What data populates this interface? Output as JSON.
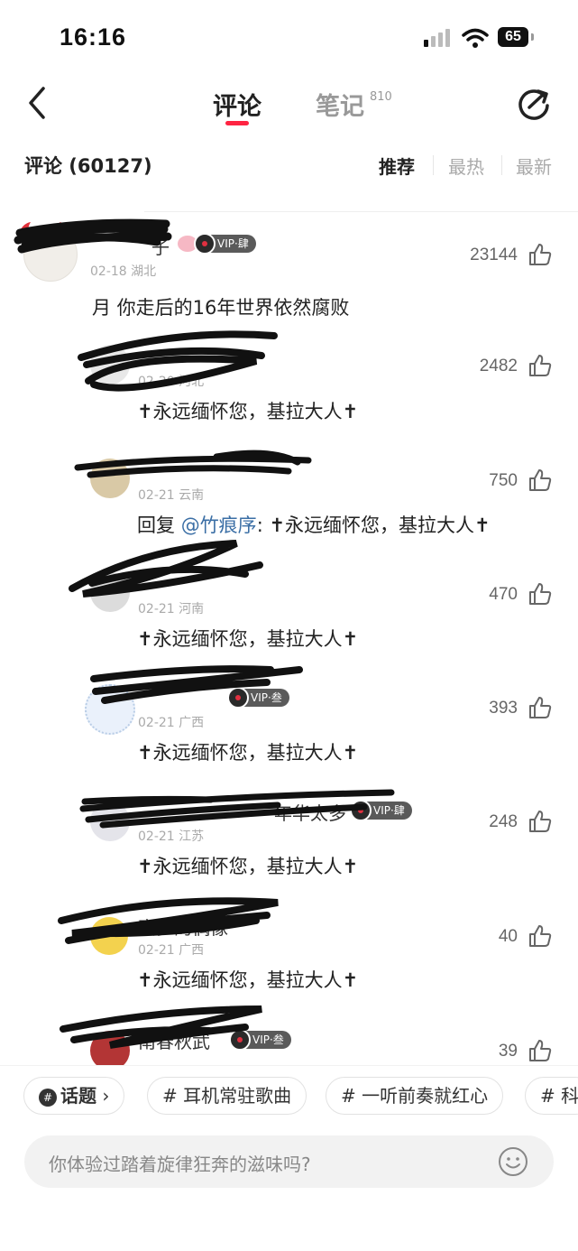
{
  "status_bar": {
    "time": "16:16",
    "battery": "65"
  },
  "nav": {
    "tab_comments": "评论",
    "tab_notes": "笔记",
    "notes_count": "810"
  },
  "header": {
    "comment_title": "评论 (60127)",
    "sort_options": [
      "推荐",
      "最热",
      "最新"
    ]
  },
  "comments": [
    {
      "username": "子",
      "vip": "VIP·肆",
      "meta": "02-18 湖北",
      "likes": "23144",
      "text": "月 你走后的16年世界依然腐败"
    },
    {
      "username": "",
      "meta": "02-20 河北",
      "likes": "2482",
      "text": "✝永远缅怀您，基拉大人✝"
    },
    {
      "username": "",
      "meta": "02-21 云南",
      "likes": "750",
      "text_prefix": "回复 ",
      "mention": "@竹痕序",
      "text": ": ✝永远缅怀您，基拉大人✝"
    },
    {
      "username": "",
      "meta": "02-21 河南",
      "likes": "470",
      "text": "✝永远缅怀您，基拉大人✝"
    },
    {
      "username": "",
      "vip": "VIP·叁",
      "meta": "02-21 广西",
      "likes": "393",
      "text": "✝永远缅怀您，基拉大人✝"
    },
    {
      "username": "年华太多",
      "vip": "VIP·肆",
      "meta": "02-21 江苏",
      "likes": "248",
      "text": "✝永远缅怀您，基拉大人✝"
    },
    {
      "username": "赛罗的偶像",
      "meta": "02-21 广西",
      "likes": "40",
      "text": "✝永远缅怀您，基拉大人✝"
    },
    {
      "username": "南春秋武",
      "vip": "VIP·叁",
      "meta": "",
      "likes": "39",
      "text": ""
    }
  ],
  "topics": {
    "label": "话题",
    "chips": [
      "# 耳机常驻歌曲",
      "# 一听前奏就红心",
      "# 科"
    ]
  },
  "input": {
    "placeholder": "你体验过踏着旋律狂奔的滋味吗?"
  },
  "colors": {
    "accent": "#ff2442",
    "mention": "#3a6ea5",
    "muted": "#aaaaaa"
  }
}
